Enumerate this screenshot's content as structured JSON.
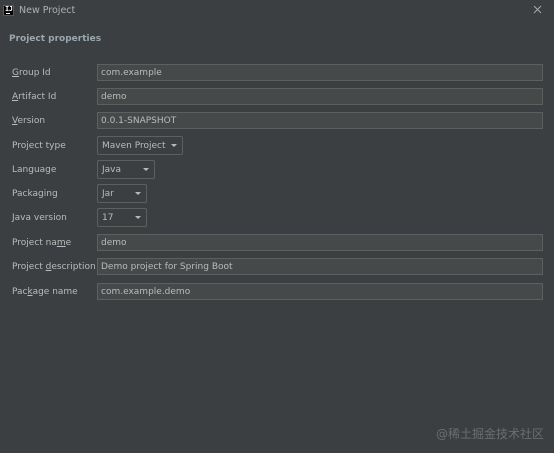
{
  "window": {
    "title": "New Project",
    "app_icon_text": "IJ"
  },
  "section": {
    "title": "Project properties"
  },
  "fields": {
    "group_id": {
      "label_mnemonic": "G",
      "label_rest": "roup Id",
      "value": "com.example"
    },
    "artifact_id": {
      "label_mnemonic": "A",
      "label_rest": "rtifact Id",
      "value": "demo"
    },
    "version": {
      "label_mnemonic": "V",
      "label_rest": "ersion",
      "value": "0.0.1-SNAPSHOT"
    },
    "project_type": {
      "label": "Project type",
      "value": "Maven Project"
    },
    "language": {
      "label": "Language",
      "value": "Java"
    },
    "packaging": {
      "label": "Packaging",
      "value": "Jar"
    },
    "java_version": {
      "label": "Java version",
      "value": "17"
    },
    "project_name": {
      "label_before": "Project na",
      "label_mnemonic": "m",
      "label_after": "e",
      "value": "demo"
    },
    "project_description": {
      "label_before": "Project ",
      "label_mnemonic": "d",
      "label_after": "escription",
      "value": "Demo project for Spring Boot"
    },
    "package_name": {
      "label_before": "Pac",
      "label_mnemonic": "k",
      "label_after": "age name",
      "value": "com.example.demo"
    }
  },
  "watermark": "@稀土掘金技术社区",
  "colors": {
    "background": "#3c3f41",
    "input_background": "#45494a",
    "border": "#5e6060",
    "text": "#bbbbbb",
    "section_title": "#9aa7b0"
  },
  "icons": {
    "app": "intellij-idea-icon",
    "close": "close-icon",
    "dropdown": "chevron-down-icon"
  }
}
